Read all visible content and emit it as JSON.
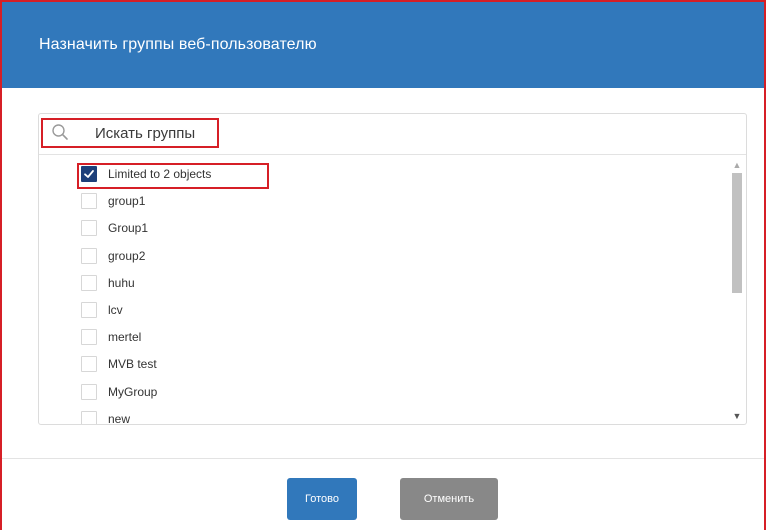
{
  "dialog": {
    "title": "Назначить группы веб-пользователю"
  },
  "search": {
    "placeholder": "Искать группы",
    "value": ""
  },
  "groups": [
    {
      "label": "Limited to 2 objects",
      "checked": true
    },
    {
      "label": "group1",
      "checked": false
    },
    {
      "label": "Group1",
      "checked": false
    },
    {
      "label": "group2",
      "checked": false
    },
    {
      "label": "huhu",
      "checked": false
    },
    {
      "label": "lcv",
      "checked": false
    },
    {
      "label": "mertel",
      "checked": false
    },
    {
      "label": "MVB test",
      "checked": false
    },
    {
      "label": "MyGroup",
      "checked": false
    },
    {
      "label": "new",
      "checked": false
    }
  ],
  "footer": {
    "done_label": "Готово",
    "cancel_label": "Отменить"
  },
  "colors": {
    "header": "#3178bb",
    "highlight": "#d61f26",
    "checkbox_checked": "#1d3f7a",
    "cancel_button": "#888888"
  },
  "icons": {
    "search": "search-icon",
    "check": "check-icon",
    "scroll_up": "chevron-up-icon",
    "scroll_down": "chevron-down-icon"
  }
}
